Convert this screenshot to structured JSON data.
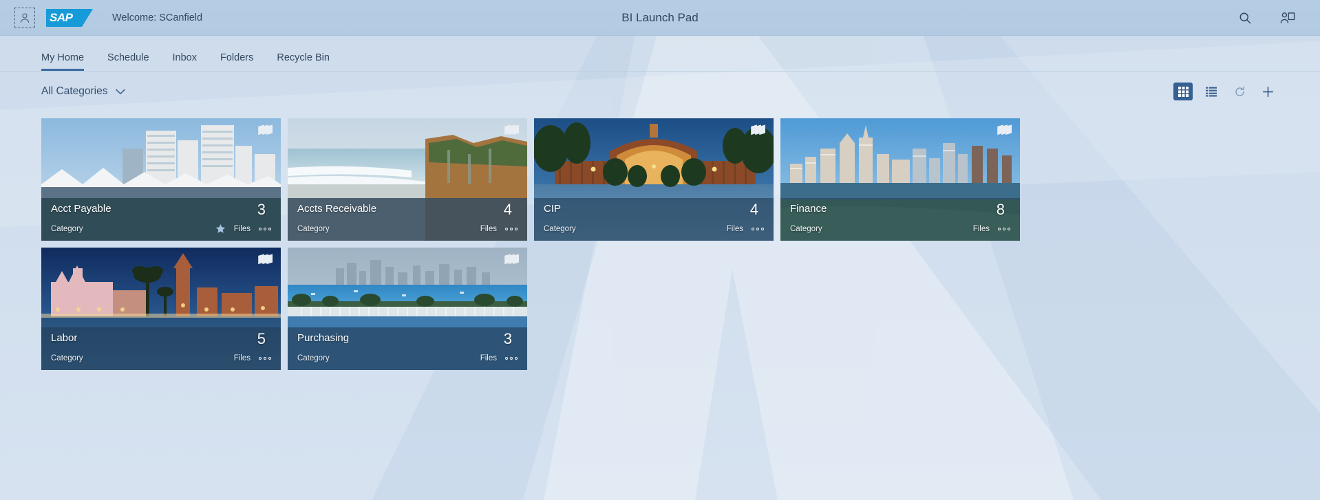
{
  "header": {
    "avatar_icon": "user-icon",
    "logo_text": "SAP",
    "welcome": "Welcome: SCanfield",
    "title": "BI Launch Pad",
    "search_icon": "search-icon",
    "contact_icon": "user-card-icon"
  },
  "nav": {
    "tabs": [
      {
        "label": "My Home",
        "active": true
      },
      {
        "label": "Schedule",
        "active": false
      },
      {
        "label": "Inbox",
        "active": false
      },
      {
        "label": "Folders",
        "active": false
      },
      {
        "label": "Recycle Bin",
        "active": false
      }
    ]
  },
  "filterbar": {
    "category_label": "All Categories",
    "chevron_icon": "chevron-down-icon",
    "toolbar": [
      {
        "name": "tile-view-button",
        "icon": "grid-icon",
        "active": true
      },
      {
        "name": "list-view-button",
        "icon": "list-icon",
        "active": false
      },
      {
        "name": "refresh-button",
        "icon": "refresh-icon",
        "active": false
      },
      {
        "name": "add-button",
        "icon": "plus-icon",
        "active": false
      }
    ]
  },
  "tiles": [
    {
      "title": "Acct Payable",
      "subtitle": "Category",
      "count": "3",
      "files_label": "Files",
      "favorite": true,
      "photo": "convention-center",
      "layers_icon": "layers-icon",
      "more_icon": "more-options-icon"
    },
    {
      "title": "Accts Receivable",
      "subtitle": "Category",
      "count": "4",
      "files_label": "Files",
      "favorite": false,
      "photo": "beach-cliffs",
      "layers_icon": "layers-icon",
      "more_icon": "more-options-icon"
    },
    {
      "title": "CIP",
      "subtitle": "Category",
      "count": "4",
      "files_label": "Files",
      "favorite": false,
      "photo": "botanical-building",
      "layers_icon": "layers-icon",
      "more_icon": "more-options-icon"
    },
    {
      "title": "Finance",
      "subtitle": "Category",
      "count": "8",
      "files_label": "Files",
      "favorite": false,
      "photo": "city-skyline",
      "layers_icon": "layers-icon",
      "more_icon": "more-options-icon"
    },
    {
      "title": "Labor",
      "subtitle": "Category",
      "count": "5",
      "files_label": "Files",
      "favorite": false,
      "photo": "balboa-park-dusk",
      "layers_icon": "layers-icon",
      "more_icon": "more-options-icon"
    },
    {
      "title": "Purchasing",
      "subtitle": "Category",
      "count": "3",
      "files_label": "Files",
      "favorite": false,
      "photo": "harbor-marina",
      "layers_icon": "layers-icon",
      "more_icon": "more-options-icon"
    }
  ],
  "colors": {
    "brand_blue": "#179ad8",
    "accent": "#3a6b9f",
    "page_bg": "#cfdced",
    "header_bg": "#b4ccE3",
    "text": "#34495f"
  }
}
